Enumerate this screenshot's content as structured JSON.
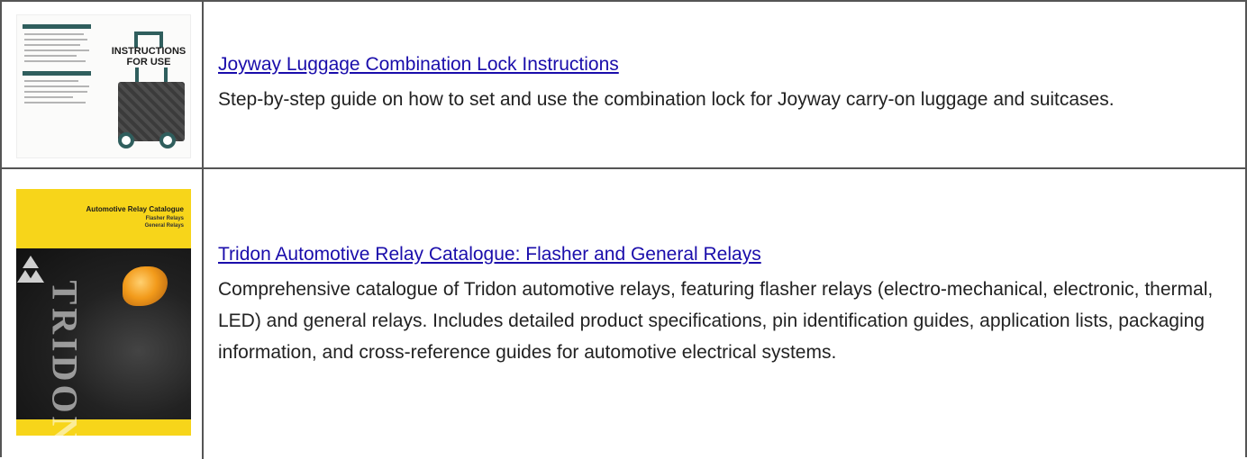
{
  "items": [
    {
      "title": "Joyway Luggage Combination Lock Instructions",
      "description": "Step-by-step guide on how to set and use the combination lock for Joyway carry-on luggage and suitcases.",
      "thumbnail": {
        "heading": "INSTRUCTIONS FOR USE"
      }
    },
    {
      "title": "Tridon Automotive Relay Catalogue: Flasher and General Relays",
      "description": "Comprehensive catalogue of Tridon automotive relays, featuring flasher relays (electro-mechanical, electronic, thermal, LED) and general relays. Includes detailed product specifications, pin identification guides, application lists, packaging information, and cross-reference guides for automotive electrical systems.",
      "thumbnail": {
        "heading": "Automotive Relay Catalogue",
        "sub1": "Flasher Relays",
        "sub2": "General Relays",
        "brand": "TRIDON"
      }
    }
  ],
  "colors": {
    "link": "#1a0dab",
    "luggage_accent": "#2f5e5d",
    "catalogue_yellow": "#f7d51a"
  }
}
